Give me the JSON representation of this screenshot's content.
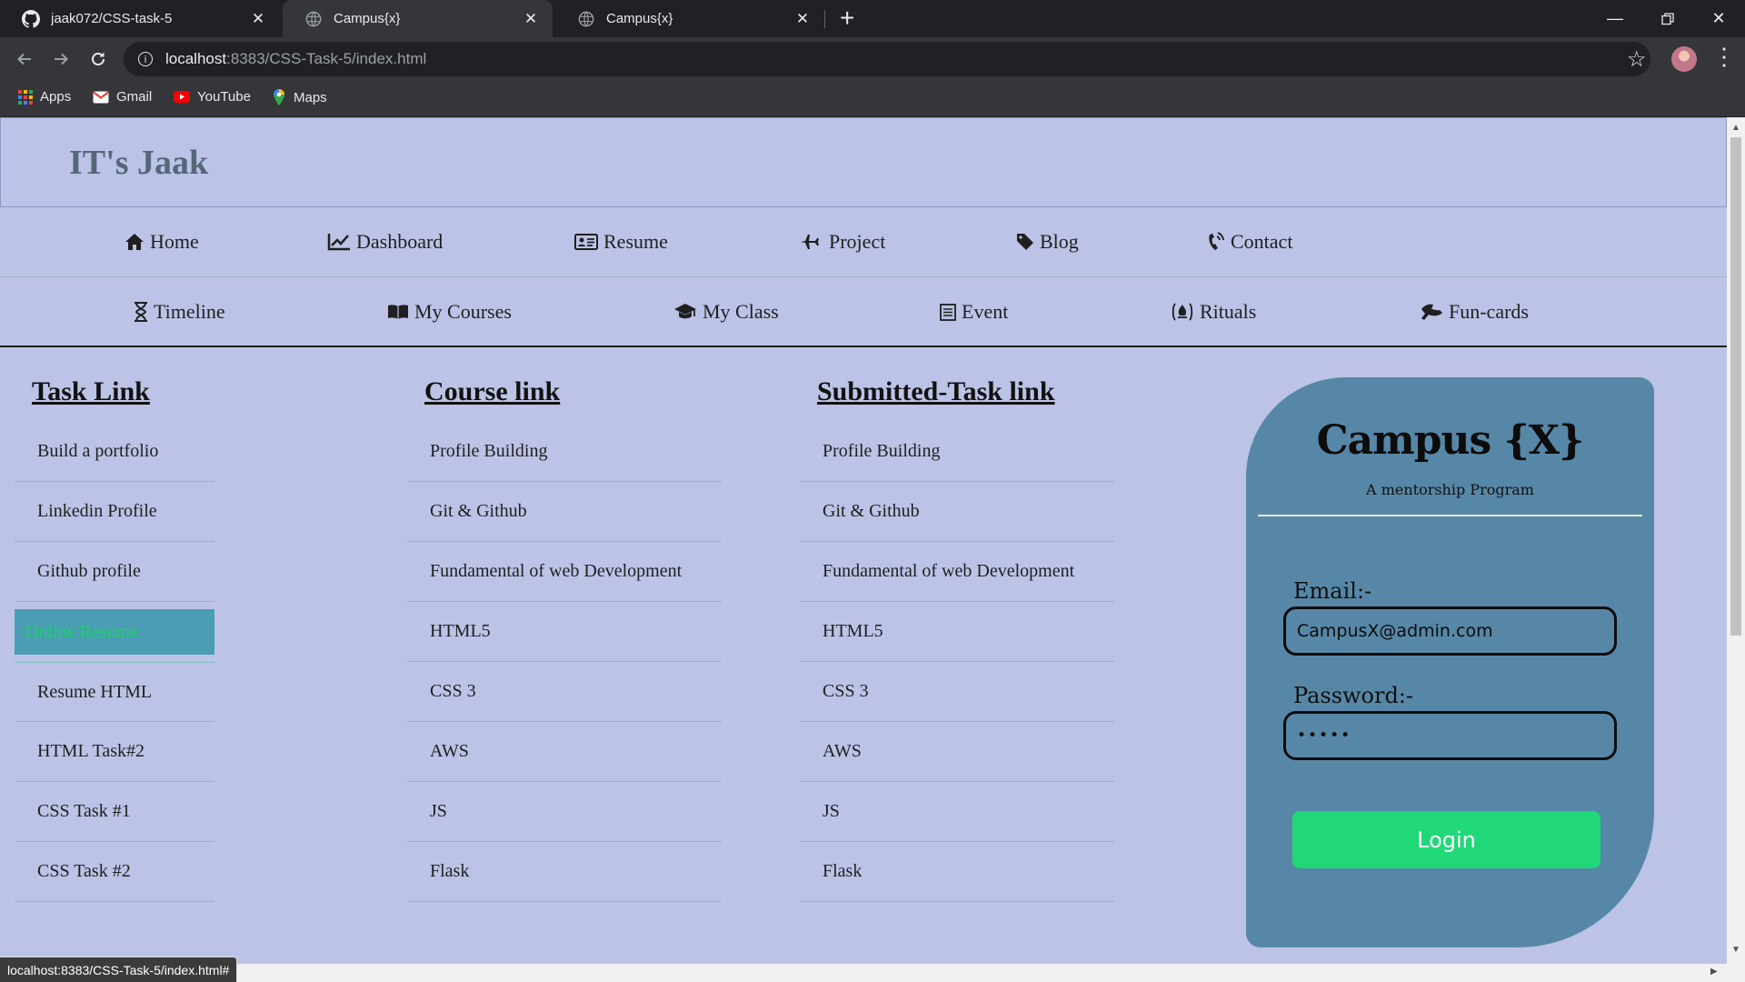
{
  "browser": {
    "tabs": [
      {
        "title": "jaak072/CSS-task-5",
        "icon": "github-icon"
      },
      {
        "title": "Campus{x}",
        "icon": "globe-icon",
        "active": true
      },
      {
        "title": "Campus{x}",
        "icon": "globe-icon"
      }
    ],
    "url_host": "localhost",
    "url_path": ":8383/CSS-Task-5/index.html",
    "bookmarks": [
      "Apps",
      "Gmail",
      "YouTube",
      "Maps"
    ],
    "status_url": "localhost:8383/CSS-Task-5/index.html#"
  },
  "site": {
    "title": "IT's Jaak",
    "nav_primary": [
      {
        "label": "Home",
        "icon": "home-icon"
      },
      {
        "label": "Dashboard",
        "icon": "chart-line-icon"
      },
      {
        "label": "Resume",
        "icon": "id-card-icon"
      },
      {
        "label": "Project",
        "icon": "plane-icon"
      },
      {
        "label": "Blog",
        "icon": "tag-icon"
      },
      {
        "label": "Contact",
        "icon": "phone-icon"
      }
    ],
    "nav_secondary": [
      {
        "label": "Timeline",
        "icon": "hourglass-icon"
      },
      {
        "label": "My Courses",
        "icon": "book-icon"
      },
      {
        "label": "My Class",
        "icon": "graduation-cap-icon"
      },
      {
        "label": "Event",
        "icon": "calendar-icon"
      },
      {
        "label": "Rituals",
        "icon": "fire-icon"
      },
      {
        "label": "Fun-cards",
        "icon": "cards-icon"
      }
    ]
  },
  "columns": {
    "task": {
      "title": "Task Link",
      "items": [
        "Build a portfolio",
        "Linkedin Profile",
        "Github profile",
        "Online Resume",
        "Resume HTML",
        "HTML Task#2",
        "CSS Task #1",
        "CSS Task #2"
      ],
      "active_index": 3
    },
    "course": {
      "title": "Course link",
      "items": [
        "Profile Building",
        "Git & Github",
        "Fundamental of web Development",
        "HTML5",
        "CSS 3",
        "AWS",
        "JS",
        "Flask"
      ]
    },
    "submitted": {
      "title": "Submitted-Task link",
      "items": [
        "Profile Building",
        "Git & Github",
        "Fundamental of web Development",
        "HTML5",
        "CSS 3",
        "AWS",
        "JS",
        "Flask"
      ]
    }
  },
  "login": {
    "title": "Campus {X}",
    "subtitle": "A mentorship Program",
    "email_label": "Email:-",
    "email_value": "CampusX@admin.com",
    "password_label": "Password:-",
    "password_value": "•••••",
    "button": "Login"
  },
  "colors": {
    "page_bg": "#bcc3e6",
    "card_bg": "#5787a6",
    "login_button": "#20d877",
    "active_link_bg": "#4a9db3",
    "active_link_text": "#1ed06c"
  }
}
